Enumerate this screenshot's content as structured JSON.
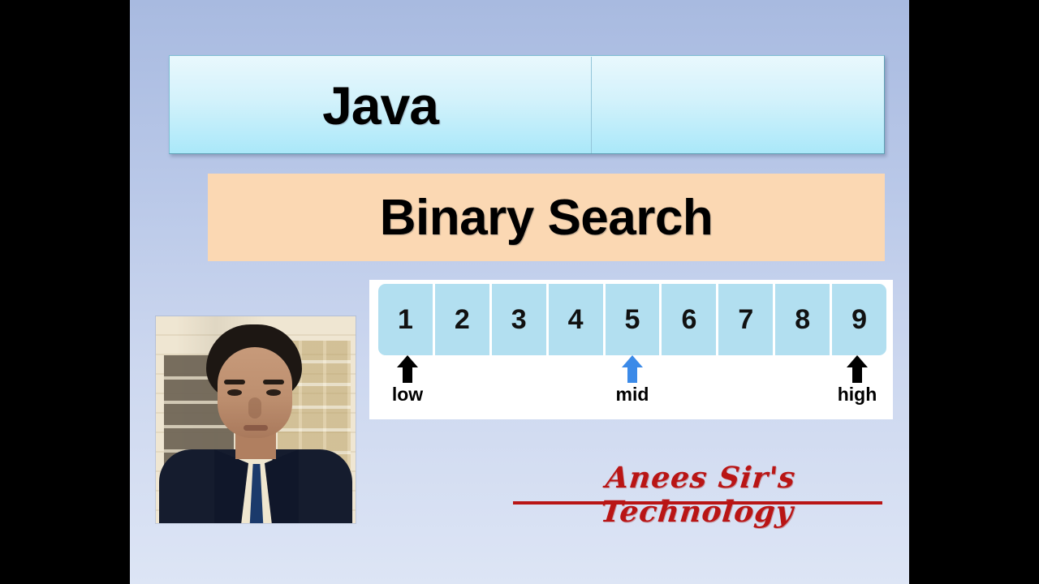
{
  "slide": {
    "background_top_color": "#a8bae0",
    "background_bottom_color": "#dde5f5",
    "letterbox_color": "#000000"
  },
  "title_banner": {
    "label": "Java",
    "background_top_color": "#e9f8fd",
    "background_bottom_color": "#aae8f9",
    "border_color": "#7fbfd4"
  },
  "topic_banner": {
    "label": "Binary Search",
    "background_color": "#fbd8b3",
    "text_color": "#000000"
  },
  "array_diagram": {
    "panel_background": "#ffffff",
    "cell_color": "#b2dff0",
    "cells": [
      {
        "value": "1"
      },
      {
        "value": "2"
      },
      {
        "value": "3"
      },
      {
        "value": "4"
      },
      {
        "value": "5"
      },
      {
        "value": "6"
      },
      {
        "value": "7"
      },
      {
        "value": "8"
      },
      {
        "value": "9"
      }
    ],
    "markers": [
      {
        "label": "low",
        "index": 0,
        "color": "#000000"
      },
      {
        "label": "mid",
        "index": 4,
        "color": "#3b8ae8"
      },
      {
        "label": "high",
        "index": 8,
        "color": "#000000"
      }
    ]
  },
  "photo": {
    "alt": "presenter-portrait"
  },
  "signature": {
    "text": "Anees Sir's Technology",
    "color": "#b91515"
  }
}
